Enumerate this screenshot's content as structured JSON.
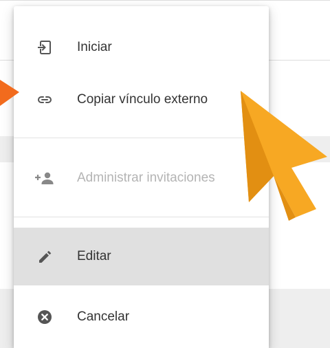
{
  "menu": {
    "items": [
      {
        "label": "Iniciar",
        "icon": "login-icon",
        "enabled": true
      },
      {
        "label": "Copiar vínculo externo",
        "icon": "link-icon",
        "enabled": true
      },
      {
        "label": "Administrar invitaciones",
        "icon": "person-add-icon",
        "enabled": false
      },
      {
        "label": "Editar",
        "icon": "pencil-icon",
        "enabled": true,
        "highlighted": true
      },
      {
        "label": "Cancelar",
        "icon": "cancel-circle-icon",
        "enabled": true
      }
    ]
  },
  "colors": {
    "menu_text": "#333333",
    "disabled_text": "#b4b4b4",
    "highlight_row": "#e0e0e0",
    "annotation_arrow": "#f26b1d",
    "cursor_fill": "#f7a823"
  }
}
